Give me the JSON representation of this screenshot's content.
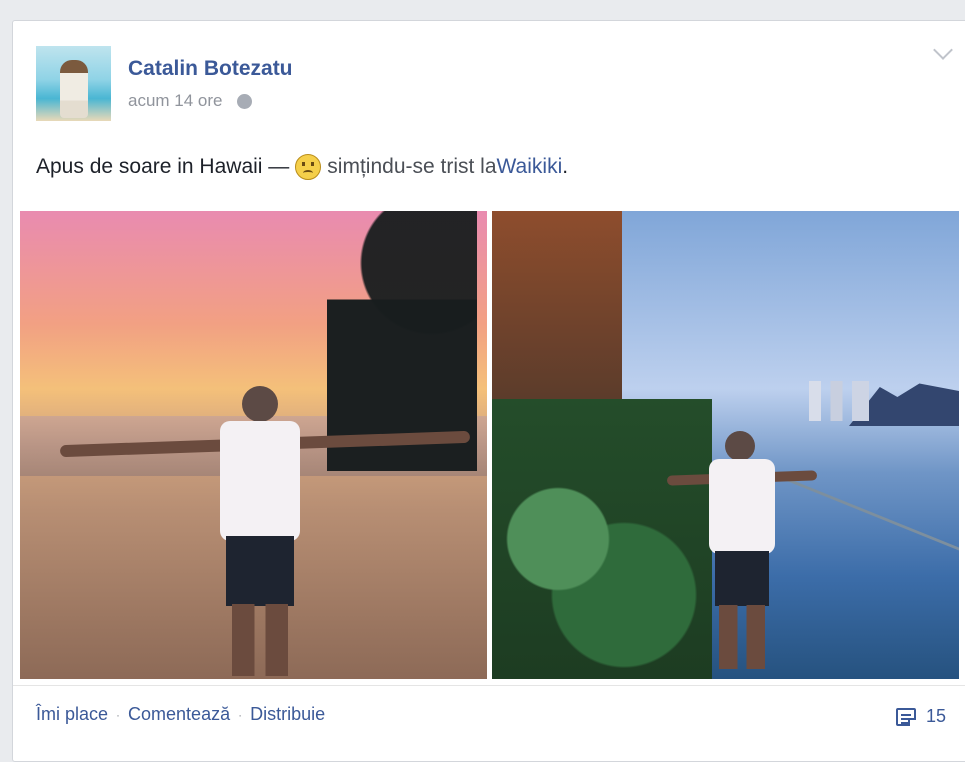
{
  "post": {
    "author_name": "Catalin Botezatu",
    "time": "acum 14 ore",
    "status_prefix": "Apus de soare in Hawaii — ",
    "feeling_text": "simțindu-se trist la ",
    "location": "Waikiki",
    "period": "."
  },
  "actions": {
    "like": "Îmi place",
    "comment": "Comentează",
    "share": "Distribuie",
    "count": "15"
  },
  "colors": {
    "link": "#3b5998",
    "muted": "#90949c",
    "text": "#1d2129"
  },
  "icons": {
    "privacy": "globe-icon",
    "menu": "chevron-down-icon",
    "emotion": "sad-face-icon",
    "comments": "comments-icon"
  }
}
